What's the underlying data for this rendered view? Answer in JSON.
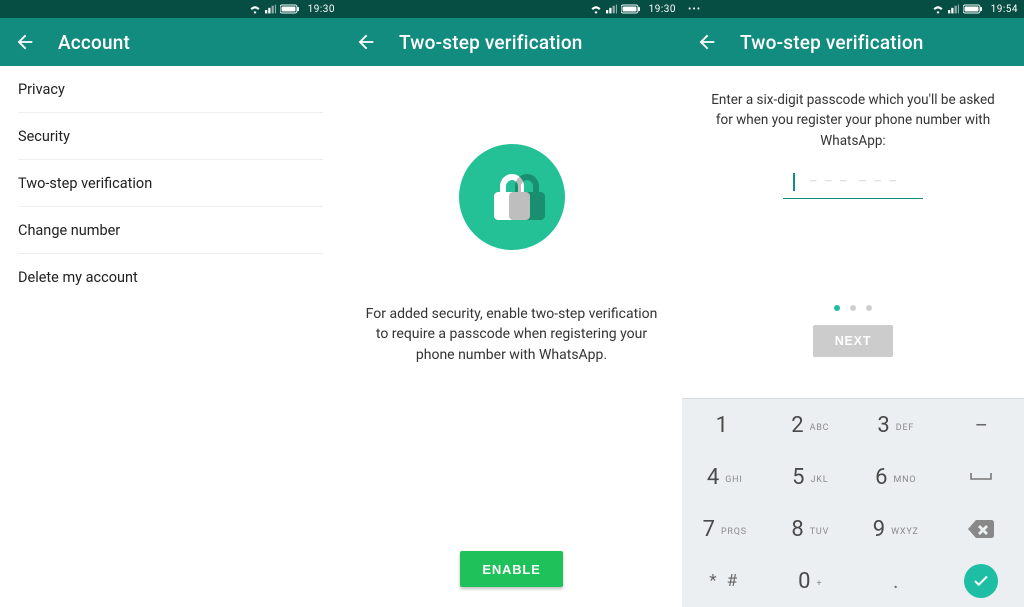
{
  "colors": {
    "brand": "#128c7e",
    "statusbar": "#064d44",
    "accent": "#1ebea5",
    "enable": "#1fc15a",
    "lock": "#24c196"
  },
  "screen1": {
    "status_time": "19:30",
    "title": "Account",
    "items": [
      "Privacy",
      "Security",
      "Two-step verification",
      "Change number",
      "Delete my account"
    ]
  },
  "screen2": {
    "status_time": "19:30",
    "title": "Two-step verification",
    "body": "For added security, enable two-step verification to require a passcode when registering your phone number with WhatsApp.",
    "enable_label": "ENABLE"
  },
  "screen3": {
    "status_time": "19:54",
    "title": "Two-step verification",
    "instruction": "Enter a six-digit passcode which you'll be asked for when you register your phone number with WhatsApp:",
    "passcode_length": 6,
    "step_dots": {
      "total": 3,
      "active": 0
    },
    "next_label": "NEXT",
    "keypad": {
      "rows": [
        [
          {
            "d": "1",
            "l": ""
          },
          {
            "d": "2",
            "l": "ABC"
          },
          {
            "d": "3",
            "l": "DEF"
          },
          {
            "d": "–",
            "side": true
          }
        ],
        [
          {
            "d": "4",
            "l": "GHI"
          },
          {
            "d": "5",
            "l": "JKL"
          },
          {
            "d": "6",
            "l": "MNO"
          },
          {
            "d": "␣",
            "side": true,
            "space": true
          }
        ],
        [
          {
            "d": "7",
            "l": "PRQS"
          },
          {
            "d": "8",
            "l": "TUV"
          },
          {
            "d": "9",
            "l": "WXYZ"
          },
          {
            "backspace": true
          }
        ],
        [
          {
            "d": "* #",
            "symbol": true
          },
          {
            "d": "0",
            "l": "+"
          },
          {
            "d": ".",
            "side": true
          },
          {
            "done": true
          }
        ]
      ]
    }
  }
}
